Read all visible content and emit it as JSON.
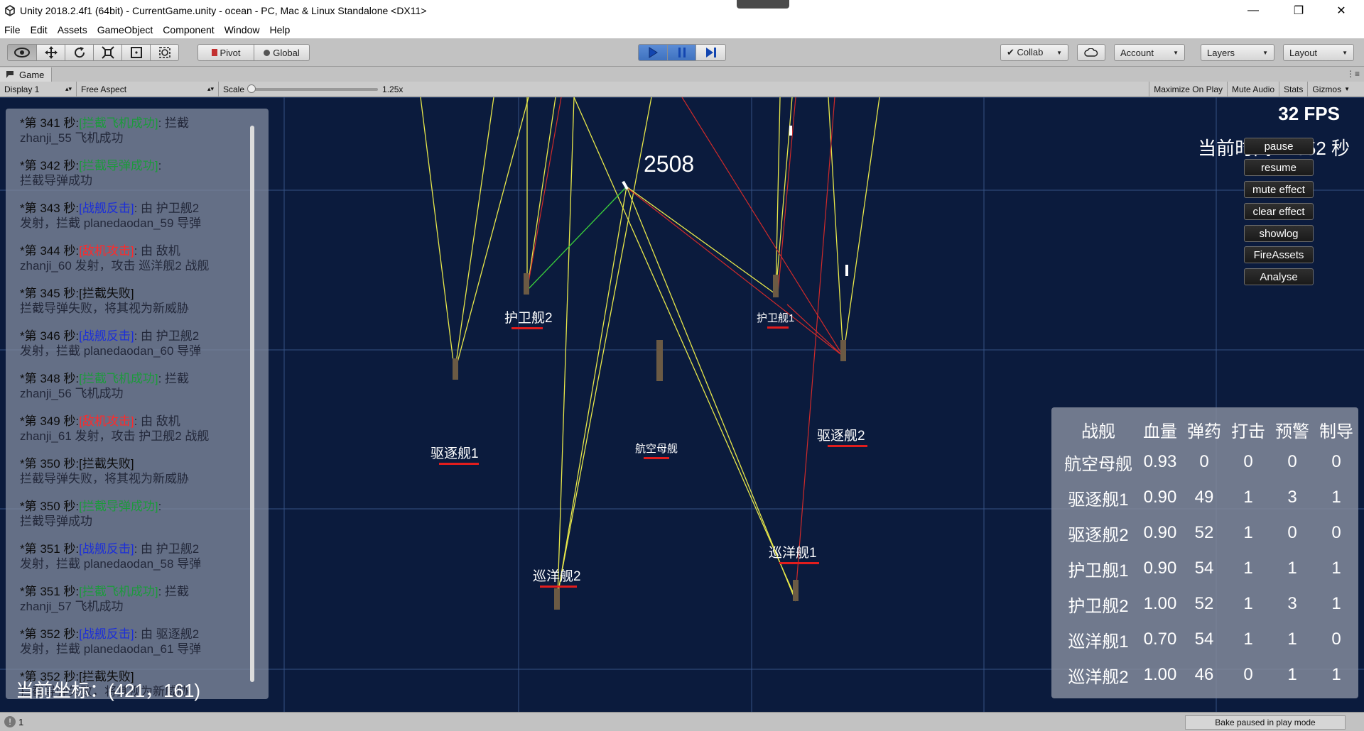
{
  "window": {
    "title": "Unity 2018.2.4f1 (64bit) - CurrentGame.unity - ocean - PC, Mac & Linux Standalone <DX11>",
    "controls": {
      "minimize": "—",
      "restore": "❐",
      "close": "✕"
    }
  },
  "menu": [
    "File",
    "Edit",
    "Assets",
    "GameObject",
    "Component",
    "Window",
    "Help"
  ],
  "toolbar": {
    "pivot": "Pivot",
    "global": "Global",
    "collab": "Collab",
    "account": "Account",
    "layers": "Layers",
    "layout": "Layout"
  },
  "tab": {
    "name": "Game"
  },
  "gamebar": {
    "display": "Display 1",
    "aspect": "Free Aspect",
    "scale_label": "Scale",
    "scale_value": "1.25x",
    "maximize": "Maximize On Play",
    "mute": "Mute Audio",
    "stats": "Stats",
    "gizmos": "Gizmos"
  },
  "hud": {
    "fps": "32 FPS",
    "time": "当前时间： 352 秒",
    "counter": "2508",
    "coord": "当前坐标：(421，161)"
  },
  "buttons": [
    "pause",
    "resume",
    "mute effect",
    "clear effect",
    "showlog",
    "FireAssets",
    "Analyse"
  ],
  "log": [
    {
      "hdr": "*第 341 秒:",
      "tag": "[拦截飞机成功]",
      "tagColor": "green",
      "l1": ": 拦截",
      "l2": "zhanji_55 飞机成功"
    },
    {
      "hdr": "*第 342 秒:",
      "tag": "[拦截导弹成功]",
      "tagColor": "green",
      "l1": ":",
      "l2": "拦截导弹成功"
    },
    {
      "hdr": "*第 343 秒:",
      "tag": "[战舰反击]",
      "tagColor": "blue",
      "l1": ": 由 护卫舰2",
      "l2": "发射，拦截 planedaodan_59 导弹"
    },
    {
      "hdr": "*第 344 秒:",
      "tag": "[敌机攻击]",
      "tagColor": "red",
      "l1": ": 由 敌机",
      "l2": "zhanji_60 发射，攻击 巡洋舰2 战舰"
    },
    {
      "hdr": "*第 345 秒:",
      "tag": "[拦截失败]",
      "tagColor": "black",
      "l1": "",
      "l2": "拦截导弹失败，将其视为新威胁"
    },
    {
      "hdr": "*第 346 秒:",
      "tag": "[战舰反击]",
      "tagColor": "blue",
      "l1": ": 由 护卫舰2",
      "l2": "发射，拦截 planedaodan_60 导弹"
    },
    {
      "hdr": "*第 348 秒:",
      "tag": "[拦截飞机成功]",
      "tagColor": "green",
      "l1": ": 拦截",
      "l2": "zhanji_56 飞机成功"
    },
    {
      "hdr": "*第 349 秒:",
      "tag": "[敌机攻击]",
      "tagColor": "red",
      "l1": ": 由 敌机",
      "l2": "zhanji_61 发射，攻击 护卫舰2 战舰"
    },
    {
      "hdr": "*第 350 秒:",
      "tag": "[拦截失败]",
      "tagColor": "black",
      "l1": "",
      "l2": "拦截导弹失败，将其视为新威胁"
    },
    {
      "hdr": "*第 350 秒:",
      "tag": "[拦截导弹成功]",
      "tagColor": "green",
      "l1": ":",
      "l2": "拦截导弹成功"
    },
    {
      "hdr": "*第 351 秒:",
      "tag": "[战舰反击]",
      "tagColor": "blue",
      "l1": ": 由 护卫舰2",
      "l2": "发射，拦截 planedaodan_58 导弹"
    },
    {
      "hdr": "*第 351 秒:",
      "tag": "[拦截飞机成功]",
      "tagColor": "green",
      "l1": ": 拦截",
      "l2": "zhanji_57 飞机成功"
    },
    {
      "hdr": "*第 352 秒:",
      "tag": "[战舰反击]",
      "tagColor": "blue",
      "l1": ": 由 驱逐舰2",
      "l2": "发射，拦截 planedaodan_61 导弹"
    },
    {
      "hdr": "*第 352 秒:",
      "tag": "[拦截失败]",
      "tagColor": "black",
      "l1": "",
      "l2": "拦截导弹失败，将其视为新威胁"
    }
  ],
  "ships": {
    "escort2": "护卫舰2",
    "escort1": "护卫舰1",
    "destroyer1": "驱逐舰1",
    "destroyer2": "驱逐舰2",
    "carrier": "航空母舰",
    "cruiser1": "巡洋舰1",
    "cruiser2": "巡洋舰2"
  },
  "stats": {
    "headers": [
      "战舰",
      "血量",
      "弹药",
      "打击",
      "预警",
      "制导"
    ],
    "rows": [
      [
        "航空母舰",
        "0.93",
        "0",
        "0",
        "0",
        "0"
      ],
      [
        "驱逐舰1",
        "0.90",
        "49",
        "1",
        "3",
        "1"
      ],
      [
        "驱逐舰2",
        "0.90",
        "52",
        "1",
        "0",
        "0"
      ],
      [
        "护卫舰1",
        "0.90",
        "54",
        "1",
        "1",
        "1"
      ],
      [
        "护卫舰2",
        "1.00",
        "52",
        "1",
        "3",
        "1"
      ],
      [
        "巡洋舰1",
        "0.70",
        "54",
        "1",
        "1",
        "0"
      ],
      [
        "巡洋舰2",
        "1.00",
        "46",
        "0",
        "1",
        "1"
      ]
    ]
  },
  "status": {
    "count": "1",
    "bake": "Bake paused in play mode"
  },
  "colors": {
    "ocean": "#0b1b3d",
    "grid": "#5a7fbf",
    "yellow_line": "#e8e84a",
    "red_line": "#d02a2a",
    "green_line": "#3bd13b",
    "underline": "#e21d1d"
  }
}
